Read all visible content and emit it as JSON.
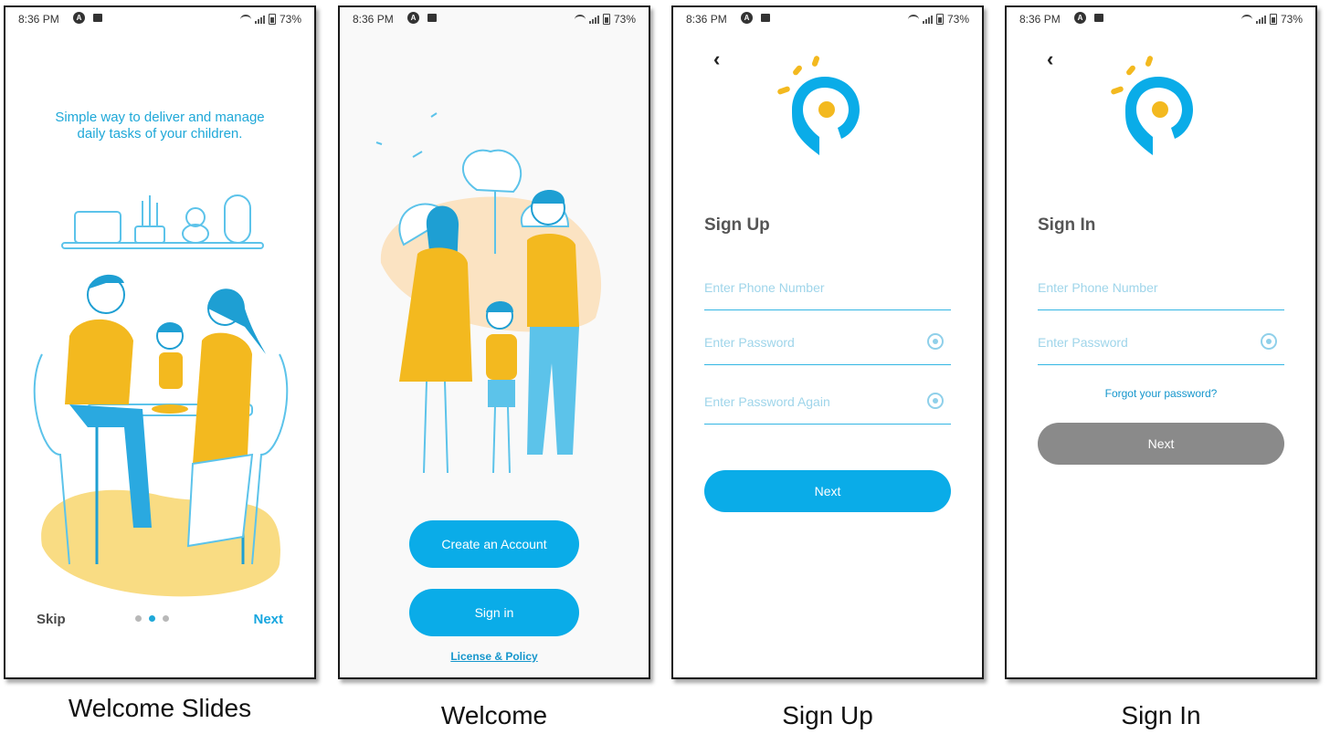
{
  "status_bar": {
    "time": "8:36 PM",
    "battery": "73%"
  },
  "screens": {
    "welcome_slides": {
      "caption": "Welcome Slides",
      "tagline_line1": "Simple way to deliver and manage",
      "tagline_line2": "daily tasks of your children.",
      "skip_label": "Skip",
      "next_label": "Next",
      "pager": {
        "count": 3,
        "active_index": 1
      }
    },
    "welcome": {
      "caption": "Welcome",
      "create_account_label": "Create an Account",
      "sign_in_label": "Sign in",
      "license_label": "License & Policy"
    },
    "sign_up": {
      "caption": "Sign Up",
      "back_icon": "chevron-left-icon",
      "title": "Sign Up",
      "phone_placeholder": "Enter Phone Number",
      "password_placeholder": "Enter Password",
      "password_again_placeholder": "Enter Password Again",
      "next_label": "Next"
    },
    "sign_in": {
      "caption": "Sign In",
      "back_icon": "chevron-left-icon",
      "title": "Sign In",
      "phone_placeholder": "Enter Phone Number",
      "password_placeholder": "Enter Password",
      "forgot_label": "Forgot your password?",
      "next_label": "Next"
    }
  },
  "colors": {
    "accent": "#0aace8",
    "illustration_yellow": "#f3b91f",
    "disabled": "#8a8a8a"
  }
}
